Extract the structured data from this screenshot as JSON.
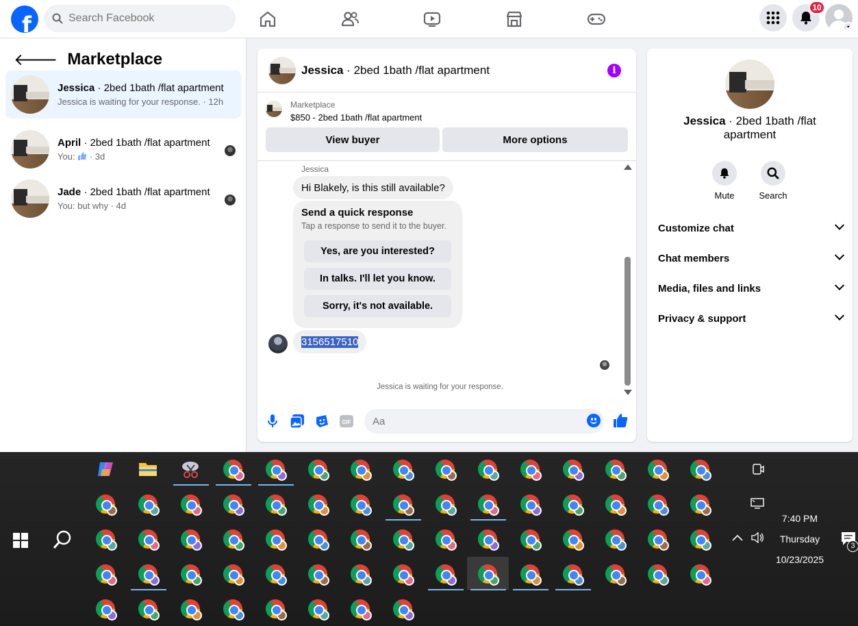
{
  "topbar": {
    "search_placeholder": "Search Facebook",
    "notification_count": "10"
  },
  "sidebar": {
    "title": "Marketplace",
    "conversations": [
      {
        "name": "Jessica",
        "listing": "· 2bed 1bath /flat apartment",
        "preview": "Jessica is waiting for your response. · 12h",
        "active": true
      },
      {
        "name": "April",
        "listing": "· 2bed 1bath /flat apartment",
        "preview_prefix": "You:",
        "preview_suffix": " · 3d"
      },
      {
        "name": "Jade",
        "listing": "· 2bed 1bath /flat apartment",
        "preview": "You: but why · 4d"
      }
    ]
  },
  "chat": {
    "header_name": "Jessica",
    "header_listing": "· 2bed 1bath /flat apartment",
    "marketplace_label": "Marketplace",
    "listing_price": "$850 - 2bed 1bath /flat apartment",
    "view_buyer_label": "View buyer",
    "more_options_label": "More options",
    "sender_label": "Jessica",
    "first_message": "Hi Blakely, is this still available?",
    "quick_response_title": "Send a quick response",
    "quick_response_sub": "Tap a response to send it to the buyer.",
    "quick_responses": [
      "Yes, are you interested?",
      "In talks. I'll let you know.",
      "Sorry, it's not available."
    ],
    "phone_message": "3156517510",
    "waiting_note": "Jessica is waiting for your response.",
    "composer_placeholder": "Aa",
    "gif_label": "GIF"
  },
  "right_panel": {
    "name": "Jessica",
    "listing": "· 2bed 1bath /flat apartment",
    "actions": [
      "Mute",
      "Search"
    ],
    "sections": [
      "Customize chat",
      "Chat members",
      "Media, files and links",
      "Privacy & support"
    ]
  },
  "taskbar": {
    "time": "7:40 PM",
    "day": "Thursday",
    "date": "10/23/2025",
    "notification_count": "3"
  },
  "colors": {
    "facebook_blue": "#0866ff",
    "active_conversation_bg": "#ebf5ff",
    "info_purple": "#a200ff",
    "notification_red": "#e41e3f",
    "taskbar_bg": "#202020",
    "selection_blue": "#3b63c5"
  }
}
